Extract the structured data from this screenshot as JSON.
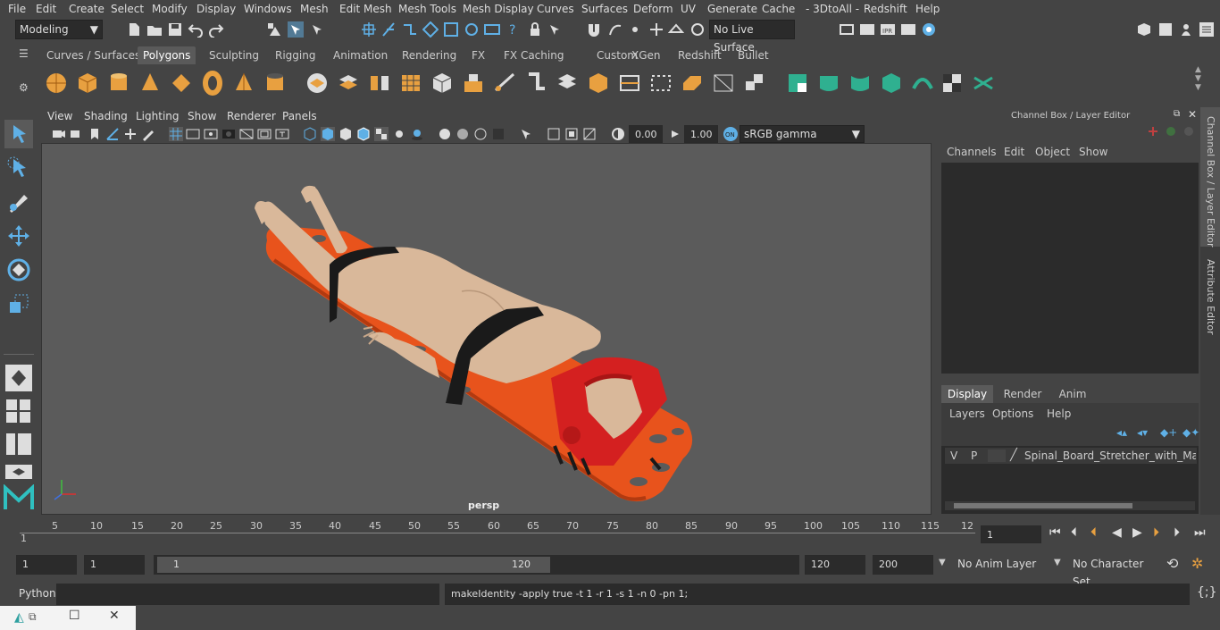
{
  "menu": [
    "File",
    "Edit",
    "Create",
    "Select",
    "Modify",
    "Display",
    "Windows",
    "Mesh",
    "Edit Mesh",
    "Mesh Tools",
    "Mesh Display",
    "Curves",
    "Surfaces",
    "Deform",
    "UV",
    "Generate",
    "Cache",
    "- 3DtoAll -",
    "Redshift",
    "Help"
  ],
  "status": {
    "mode": "Modeling",
    "live_surface": "No Live Surface"
  },
  "shelf_tabs": [
    "Curves / Surfaces",
    "Polygons",
    "Sculpting",
    "Rigging",
    "Animation",
    "Rendering",
    "FX",
    "FX Caching",
    "Custom",
    "XGen",
    "Redshift",
    "Bullet"
  ],
  "active_shelf_tab": "Polygons",
  "viewport": {
    "menu": [
      "View",
      "Shading",
      "Lighting",
      "Show",
      "Renderer",
      "Panels"
    ],
    "exposure": "0.00",
    "gamma": "1.00",
    "colorspace": "sRGB gamma",
    "camera_label": "persp"
  },
  "channel_box": {
    "title": "Channel Box / Layer Editor",
    "menu": [
      "Channels",
      "Edit",
      "Object",
      "Show"
    ],
    "layer_tabs": [
      "Display",
      "Render",
      "Anim"
    ],
    "active_layer_tab": "Display",
    "layer_menu": [
      "Layers",
      "Options",
      "Help"
    ],
    "layer": {
      "v": "V",
      "p": "P",
      "name": "Spinal_Board_Stretcher_with_Manikin"
    }
  },
  "side_tabs": [
    "Channel Box / Layer Editor",
    "Attribute Editor"
  ],
  "timeline": {
    "ticks": [
      "5",
      "10",
      "15",
      "20",
      "25",
      "30",
      "35",
      "40",
      "45",
      "50",
      "55",
      "60",
      "65",
      "70",
      "75",
      "80",
      "85",
      "90",
      "95",
      "100",
      "105",
      "110",
      "115",
      "12"
    ],
    "start_label": "1",
    "current_frame": "1"
  },
  "range": {
    "start": "1",
    "playback_start": "1",
    "slider_start": "1",
    "slider_end": "120",
    "end": "120",
    "anim_end": "200",
    "anim_layer": "No Anim Layer",
    "character_set": "No Character Set"
  },
  "command": {
    "language": "Python",
    "result": "makeIdentity -apply true -t 1 -r 1 -s 1 -n 0 -pn 1;"
  },
  "colors": {
    "accent": "#5fb0e6",
    "stretcher": "#e8531c",
    "head_block": "#d42020",
    "skin": "#d9b89a",
    "strap": "#1a1a1a"
  }
}
